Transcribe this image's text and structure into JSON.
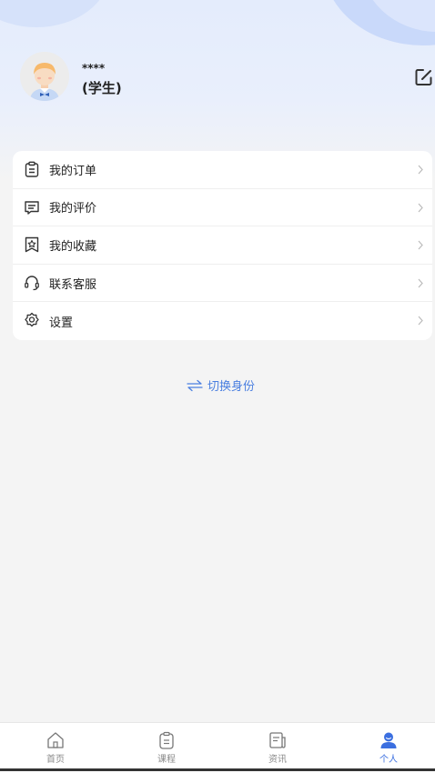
{
  "profile": {
    "name": "****",
    "role": "(学生)"
  },
  "menu": [
    {
      "label": "我的订单",
      "icon": "clipboard-icon"
    },
    {
      "label": "我的评价",
      "icon": "comment-icon"
    },
    {
      "label": "我的收藏",
      "icon": "bookmark-star-icon"
    },
    {
      "label": "联系客服",
      "icon": "headset-icon"
    },
    {
      "label": "设置",
      "icon": "gear-icon"
    }
  ],
  "switch_role": {
    "label": "切换身份",
    "icon": "swap-icon"
  },
  "tabbar": [
    {
      "label": "首页",
      "icon": "home-icon",
      "active": false
    },
    {
      "label": "课程",
      "icon": "course-icon",
      "active": false
    },
    {
      "label": "资讯",
      "icon": "news-icon",
      "active": false
    },
    {
      "label": "个人",
      "icon": "person-icon",
      "active": true
    }
  ],
  "colors": {
    "accent": "#3b6fe0",
    "background": "#f4f4f4",
    "hero": "#e6edfc"
  }
}
